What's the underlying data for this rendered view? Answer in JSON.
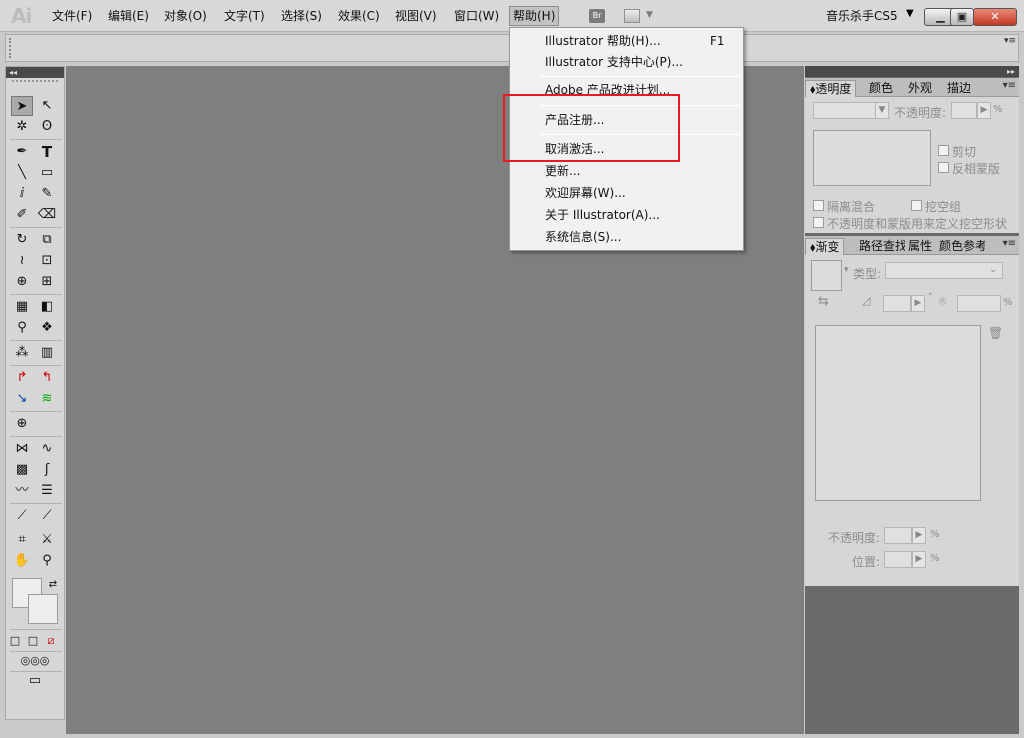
{
  "app": {
    "logo": "Ai",
    "workspace": "音乐杀手CS5",
    "bridge_label": "Br"
  },
  "menubar": {
    "items": [
      "文件(F)",
      "编辑(E)",
      "对象(O)",
      "文字(T)",
      "选择(S)",
      "效果(C)",
      "视图(V)",
      "窗口(W)",
      "帮助(H)"
    ],
    "active": "帮助(H)"
  },
  "help_menu": {
    "items": [
      {
        "label": "Illustrator 帮助(H)...",
        "shortcut": "F1"
      },
      {
        "label": "Illustrator 支持中心(P)..."
      },
      {
        "label": "Adobe 产品改进计划..."
      },
      {
        "label": "产品注册..."
      },
      {
        "label": "取消激活..."
      },
      {
        "label": "更新..."
      },
      {
        "label": "欢迎屏幕(W)..."
      },
      {
        "label": "关于 Illustrator(A)..."
      },
      {
        "label": "系统信息(S)..."
      }
    ],
    "highlight_color": "#e51c23"
  },
  "transparency_panel": {
    "tabs": [
      "透明度",
      "颜色",
      "外观",
      "描边"
    ],
    "opacity_label": "不透明度:",
    "percent": "%",
    "clip_label": "剪切",
    "invert_mask_label": "反相蒙版",
    "isolate_blend_label": "隔离混合",
    "knockout_group_label": "挖空组",
    "opacity_mask_label": "不透明度和蒙版用来定义挖空形状"
  },
  "gradient_panel": {
    "tabs": [
      "渐变",
      "路径查找器",
      "属性",
      "颜色参考"
    ],
    "type_label": "类型:",
    "degree": "°",
    "percent": "%",
    "opacity_label": "不透明度:",
    "location_label": "位置:"
  },
  "colors": {
    "canvas": "#7f7f7f",
    "panel": "#d6d6d6",
    "dock_bg": "#6a6a6a"
  }
}
